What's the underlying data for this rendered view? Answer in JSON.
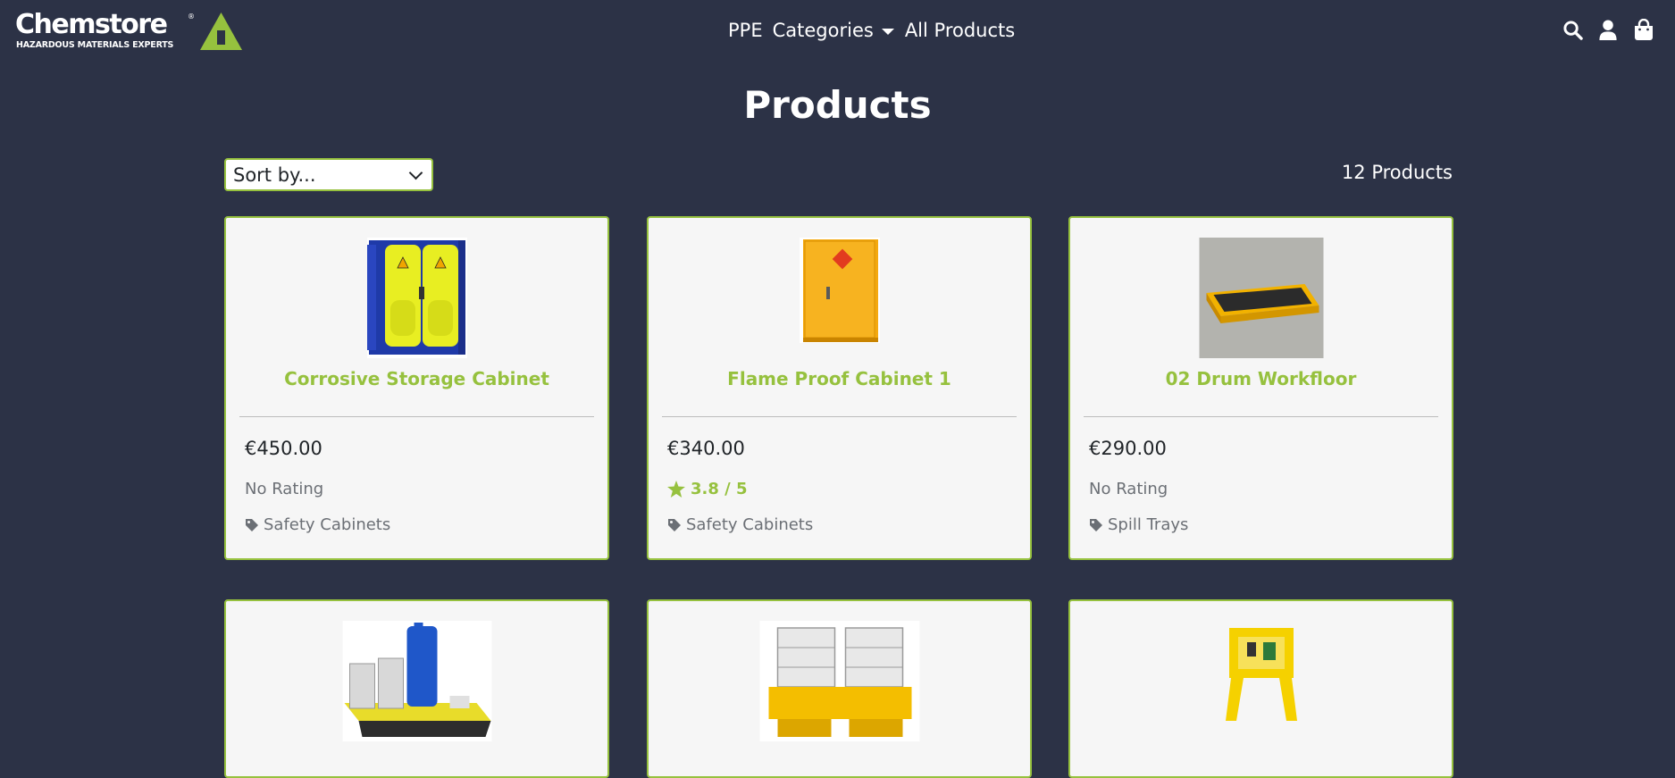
{
  "brand": {
    "name": "Chemstore",
    "registered": "®",
    "tagline": "HAZARDOUS MATERIALS EXPERTS"
  },
  "nav": {
    "ppe": "PPE",
    "categories": "Categories",
    "all_products": "All Products"
  },
  "header_icons": [
    "search-icon",
    "user-icon",
    "shopping-bag-icon"
  ],
  "page": {
    "title": "Products"
  },
  "toolbar": {
    "sort_label": "Sort by...",
    "product_count": "12 Products"
  },
  "colors": {
    "background": "#2c3246",
    "accent": "#96c13e",
    "card": "#f6f6f6"
  },
  "products": [
    {
      "name": "Corrosive Storage Cabinet",
      "price": "€450.00",
      "rating": "No Rating",
      "rated": false,
      "category": "Safety Cabinets"
    },
    {
      "name": "Flame Proof Cabinet 1",
      "price": "€340.00",
      "rating": "3.8 / 5",
      "rated": true,
      "category": "Safety Cabinets"
    },
    {
      "name": "02 Drum Workfloor",
      "price": "€290.00",
      "rating": "No Rating",
      "rated": false,
      "category": "Spill Trays"
    },
    {
      "name": ""
    },
    {
      "name": ""
    },
    {
      "name": ""
    }
  ]
}
